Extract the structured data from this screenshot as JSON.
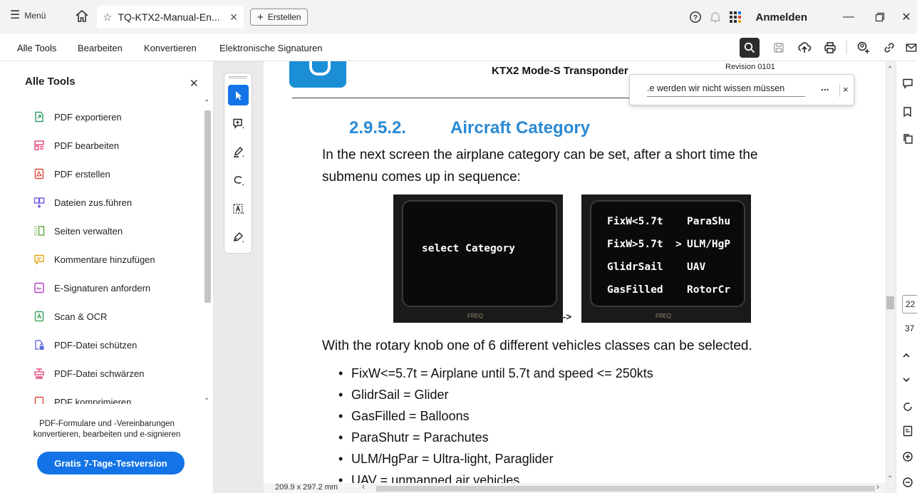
{
  "titlebar": {
    "menu_label": "Menü",
    "tab_title": "TQ-KTX2-Manual-En...",
    "create_label": "Erstellen",
    "login_label": "Anmelden"
  },
  "toolbar": {
    "tabs": [
      "Alle Tools",
      "Bearbeiten",
      "Konvertieren",
      "Elektronische Signaturen"
    ]
  },
  "sidebar": {
    "title": "Alle Tools",
    "items": [
      {
        "label": "PDF exportieren",
        "icon": "export-pdf-icon",
        "color": "#2e9e6a"
      },
      {
        "label": "PDF bearbeiten",
        "icon": "edit-pdf-icon",
        "color": "#e0437a"
      },
      {
        "label": "PDF erstellen",
        "icon": "create-pdf-icon",
        "color": "#e0443a"
      },
      {
        "label": "Dateien zus.führen",
        "icon": "combine-files-icon",
        "color": "#6b5be0"
      },
      {
        "label": "Seiten verwalten",
        "icon": "organize-pages-icon",
        "color": "#5aa638"
      },
      {
        "label": "Kommentare hinzufügen",
        "icon": "comment-icon",
        "color": "#e8a317"
      },
      {
        "label": "E-Signaturen anfordern",
        "icon": "request-esign-icon",
        "color": "#b03fc0"
      },
      {
        "label": "Scan & OCR",
        "icon": "scan-ocr-icon",
        "color": "#3aa65a"
      },
      {
        "label": "PDF-Datei schützen",
        "icon": "protect-pdf-icon",
        "color": "#5f6bdc"
      },
      {
        "label": "PDF-Datei schwärzen",
        "icon": "redact-pdf-icon",
        "color": "#e0437a"
      },
      {
        "label": "PDF komprimieren",
        "icon": "compress-pdf-icon",
        "color": "#e0443a"
      }
    ],
    "promo_text": "PDF-Formulare und -Vereinbarungen konvertieren, bearbeiten und e-signieren",
    "cta_label": "Gratis 7-Tage-Testversion"
  },
  "document": {
    "header_title": "KTX2 Mode-S Transponder",
    "revision": "Revision 0101",
    "section_number": "2.9.5.2.",
    "section_title": "Aircraft Category",
    "intro_line1": "In the next screen the airplane category can be set, after a short time the",
    "intro_line2": "submenu comes up in sequence:",
    "lcd1_text": "select Category",
    "lcd2_rows": [
      [
        "FixW<5.7t",
        "ParaShu"
      ],
      [
        "FixW>5.7t",
        ">",
        "ULM/HgP"
      ],
      [
        "GlidrSail",
        "UAV"
      ],
      [
        "GasFilled",
        "RotorCr"
      ]
    ],
    "lcd_brand": "FREQ",
    "arrow": "->",
    "rotary_text": "With the rotary knob one of 6 different vehicles classes can be selected.",
    "bullets": [
      "FixW<=5.7t = Airplane until 5.7t and speed <= 250kts",
      "GlidrSail = Glider",
      "GasFilled = Balloons",
      "ParaShutr = Parachutes",
      "ULM/HgPar = Ultra-light, Paraglider",
      "UAV = unmanned air vehicles"
    ],
    "page_size": "209.9 x 297.2 mm"
  },
  "findbar": {
    "text": "e werden wir nicht wissen müssen.",
    "more": "...",
    "close": "×"
  },
  "page_nav": {
    "current": "22",
    "total": "37"
  },
  "colors": {
    "accent": "#1473e6",
    "heading_blue": "#2a8ad4"
  }
}
